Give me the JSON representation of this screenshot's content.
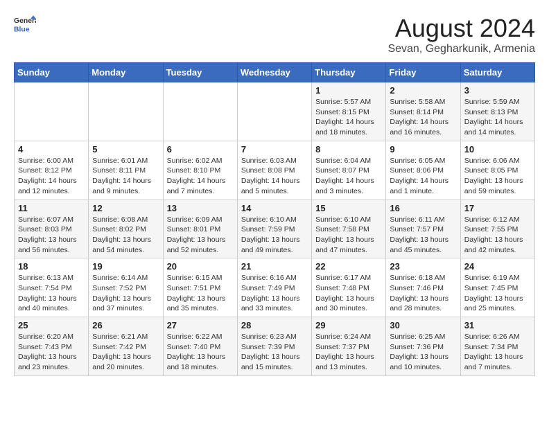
{
  "logo": {
    "line1": "General",
    "line2": "Blue"
  },
  "title": "August 2024",
  "subtitle": "Sevan, Gegharkunik, Armenia",
  "weekdays": [
    "Sunday",
    "Monday",
    "Tuesday",
    "Wednesday",
    "Thursday",
    "Friday",
    "Saturday"
  ],
  "weeks": [
    [
      {
        "day": "",
        "info": ""
      },
      {
        "day": "",
        "info": ""
      },
      {
        "day": "",
        "info": ""
      },
      {
        "day": "",
        "info": ""
      },
      {
        "day": "1",
        "info": "Sunrise: 5:57 AM\nSunset: 8:15 PM\nDaylight: 14 hours\nand 18 minutes."
      },
      {
        "day": "2",
        "info": "Sunrise: 5:58 AM\nSunset: 8:14 PM\nDaylight: 14 hours\nand 16 minutes."
      },
      {
        "day": "3",
        "info": "Sunrise: 5:59 AM\nSunset: 8:13 PM\nDaylight: 14 hours\nand 14 minutes."
      }
    ],
    [
      {
        "day": "4",
        "info": "Sunrise: 6:00 AM\nSunset: 8:12 PM\nDaylight: 14 hours\nand 12 minutes."
      },
      {
        "day": "5",
        "info": "Sunrise: 6:01 AM\nSunset: 8:11 PM\nDaylight: 14 hours\nand 9 minutes."
      },
      {
        "day": "6",
        "info": "Sunrise: 6:02 AM\nSunset: 8:10 PM\nDaylight: 14 hours\nand 7 minutes."
      },
      {
        "day": "7",
        "info": "Sunrise: 6:03 AM\nSunset: 8:08 PM\nDaylight: 14 hours\nand 5 minutes."
      },
      {
        "day": "8",
        "info": "Sunrise: 6:04 AM\nSunset: 8:07 PM\nDaylight: 14 hours\nand 3 minutes."
      },
      {
        "day": "9",
        "info": "Sunrise: 6:05 AM\nSunset: 8:06 PM\nDaylight: 14 hours\nand 1 minute."
      },
      {
        "day": "10",
        "info": "Sunrise: 6:06 AM\nSunset: 8:05 PM\nDaylight: 13 hours\nand 59 minutes."
      }
    ],
    [
      {
        "day": "11",
        "info": "Sunrise: 6:07 AM\nSunset: 8:03 PM\nDaylight: 13 hours\nand 56 minutes."
      },
      {
        "day": "12",
        "info": "Sunrise: 6:08 AM\nSunset: 8:02 PM\nDaylight: 13 hours\nand 54 minutes."
      },
      {
        "day": "13",
        "info": "Sunrise: 6:09 AM\nSunset: 8:01 PM\nDaylight: 13 hours\nand 52 minutes."
      },
      {
        "day": "14",
        "info": "Sunrise: 6:10 AM\nSunset: 7:59 PM\nDaylight: 13 hours\nand 49 minutes."
      },
      {
        "day": "15",
        "info": "Sunrise: 6:10 AM\nSunset: 7:58 PM\nDaylight: 13 hours\nand 47 minutes."
      },
      {
        "day": "16",
        "info": "Sunrise: 6:11 AM\nSunset: 7:57 PM\nDaylight: 13 hours\nand 45 minutes."
      },
      {
        "day": "17",
        "info": "Sunrise: 6:12 AM\nSunset: 7:55 PM\nDaylight: 13 hours\nand 42 minutes."
      }
    ],
    [
      {
        "day": "18",
        "info": "Sunrise: 6:13 AM\nSunset: 7:54 PM\nDaylight: 13 hours\nand 40 minutes."
      },
      {
        "day": "19",
        "info": "Sunrise: 6:14 AM\nSunset: 7:52 PM\nDaylight: 13 hours\nand 37 minutes."
      },
      {
        "day": "20",
        "info": "Sunrise: 6:15 AM\nSunset: 7:51 PM\nDaylight: 13 hours\nand 35 minutes."
      },
      {
        "day": "21",
        "info": "Sunrise: 6:16 AM\nSunset: 7:49 PM\nDaylight: 13 hours\nand 33 minutes."
      },
      {
        "day": "22",
        "info": "Sunrise: 6:17 AM\nSunset: 7:48 PM\nDaylight: 13 hours\nand 30 minutes."
      },
      {
        "day": "23",
        "info": "Sunrise: 6:18 AM\nSunset: 7:46 PM\nDaylight: 13 hours\nand 28 minutes."
      },
      {
        "day": "24",
        "info": "Sunrise: 6:19 AM\nSunset: 7:45 PM\nDaylight: 13 hours\nand 25 minutes."
      }
    ],
    [
      {
        "day": "25",
        "info": "Sunrise: 6:20 AM\nSunset: 7:43 PM\nDaylight: 13 hours\nand 23 minutes."
      },
      {
        "day": "26",
        "info": "Sunrise: 6:21 AM\nSunset: 7:42 PM\nDaylight: 13 hours\nand 20 minutes."
      },
      {
        "day": "27",
        "info": "Sunrise: 6:22 AM\nSunset: 7:40 PM\nDaylight: 13 hours\nand 18 minutes."
      },
      {
        "day": "28",
        "info": "Sunrise: 6:23 AM\nSunset: 7:39 PM\nDaylight: 13 hours\nand 15 minutes."
      },
      {
        "day": "29",
        "info": "Sunrise: 6:24 AM\nSunset: 7:37 PM\nDaylight: 13 hours\nand 13 minutes."
      },
      {
        "day": "30",
        "info": "Sunrise: 6:25 AM\nSunset: 7:36 PM\nDaylight: 13 hours\nand 10 minutes."
      },
      {
        "day": "31",
        "info": "Sunrise: 6:26 AM\nSunset: 7:34 PM\nDaylight: 13 hours\nand 7 minutes."
      }
    ]
  ]
}
